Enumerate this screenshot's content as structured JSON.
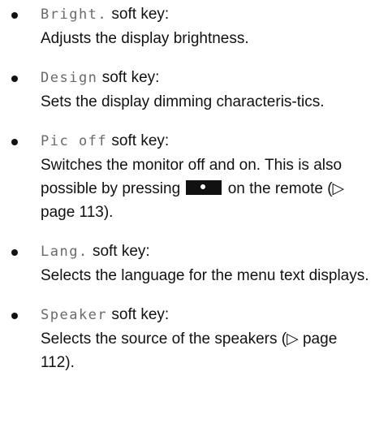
{
  "items": [
    {
      "key": "Bright.",
      "suffix": " soft key:",
      "desc": "Adjusts the display brightness."
    },
    {
      "key": "Design",
      "suffix": " soft key:",
      "desc": "Sets the display dimming characteris-tics."
    },
    {
      "key": "Pic off",
      "suffix": " soft key:",
      "desc_before": "Switches the monitor off and on. This is also possible by pressing ",
      "desc_after": " on the remote (▷ page 113).",
      "icon": "monitor-button-icon"
    },
    {
      "key": "Lang.",
      "suffix": " soft key:",
      "desc": "Selects the language for the menu text displays."
    },
    {
      "key": "Speaker",
      "suffix": " soft key:",
      "desc": "Selects the source of the speakers (▷ page 112)."
    }
  ]
}
